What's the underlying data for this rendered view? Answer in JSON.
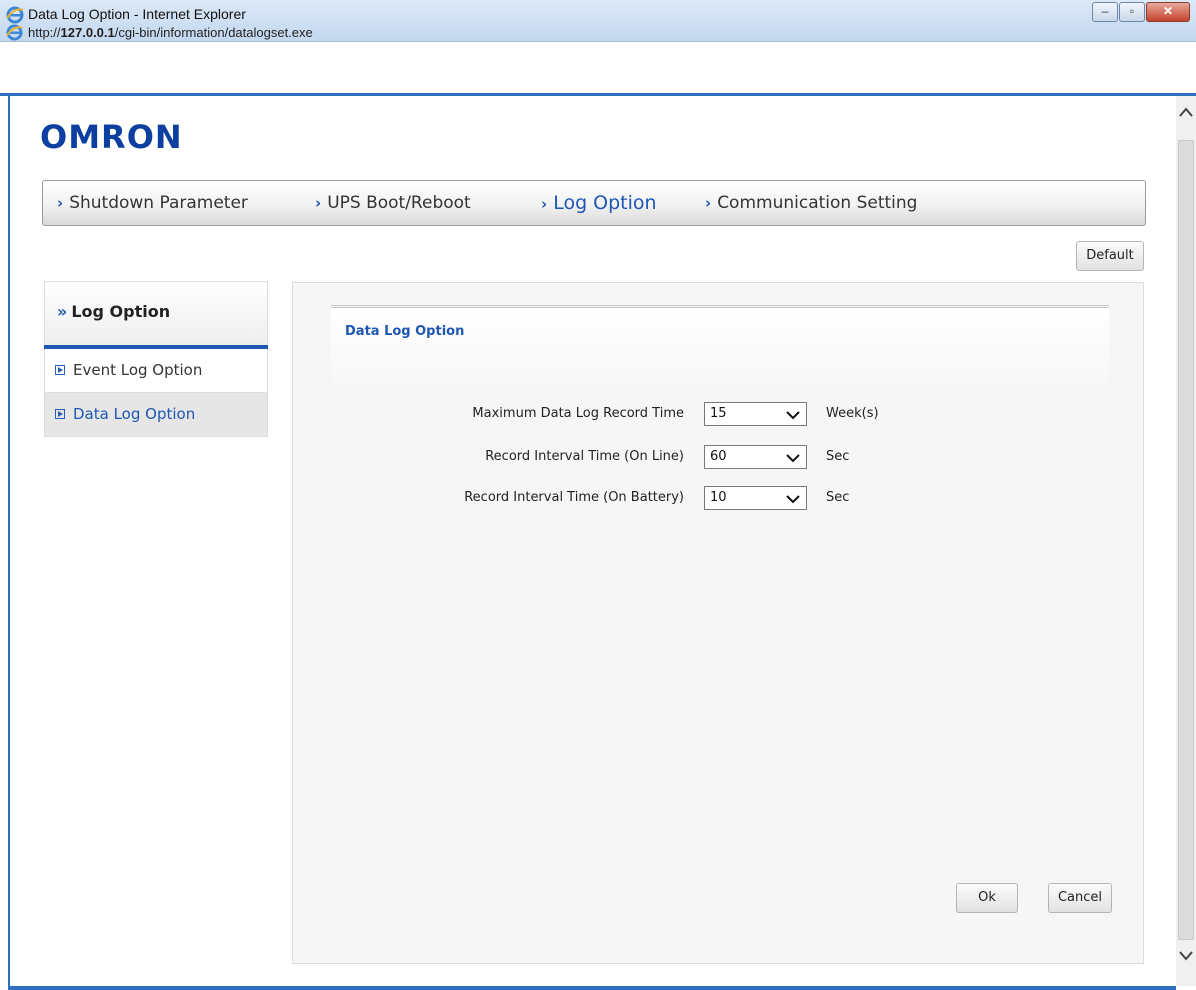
{
  "window": {
    "title": "Data Log Option - Internet Explorer",
    "url_prefix": "http://",
    "url_host": "127.0.0.1",
    "url_path": "/cgi-bin/information/datalogset.exe",
    "minimize": "–",
    "restore": "▫",
    "close": "✕"
  },
  "logo": {
    "text": "OMRON"
  },
  "topnav": {
    "items": [
      {
        "label": "Shutdown Parameter"
      },
      {
        "label": "UPS Boot/Reboot"
      },
      {
        "label": "Log Option"
      },
      {
        "label": "Communication Setting"
      }
    ],
    "active": "Log Option",
    "chevron": "›"
  },
  "default_button": "Default",
  "sidebar": {
    "header": "Log Option",
    "header_icon": "»",
    "items": [
      {
        "label": "Event Log Option"
      },
      {
        "label": "Data Log Option"
      }
    ],
    "selected": "Data Log Option"
  },
  "panel": {
    "title": "Data Log Option",
    "rows": [
      {
        "label": "Maximum Data Log Record Time",
        "value": "15",
        "unit": "Week(s)"
      },
      {
        "label": "Record Interval Time (On Line)",
        "value": "60",
        "unit": "Sec"
      },
      {
        "label": "Record Interval Time (On Battery)",
        "value": "10",
        "unit": "Sec"
      }
    ],
    "dropdown_arrow": "✓"
  },
  "buttons": {
    "ok": "Ok",
    "cancel": "Cancel"
  },
  "colors": {
    "accent": "#1f56b3",
    "logo": "#0c3fa0",
    "frame": "#2e6fc3"
  },
  "icons": {
    "browser": "ie-icon",
    "scroll_up": "^",
    "scroll_down": "v"
  }
}
